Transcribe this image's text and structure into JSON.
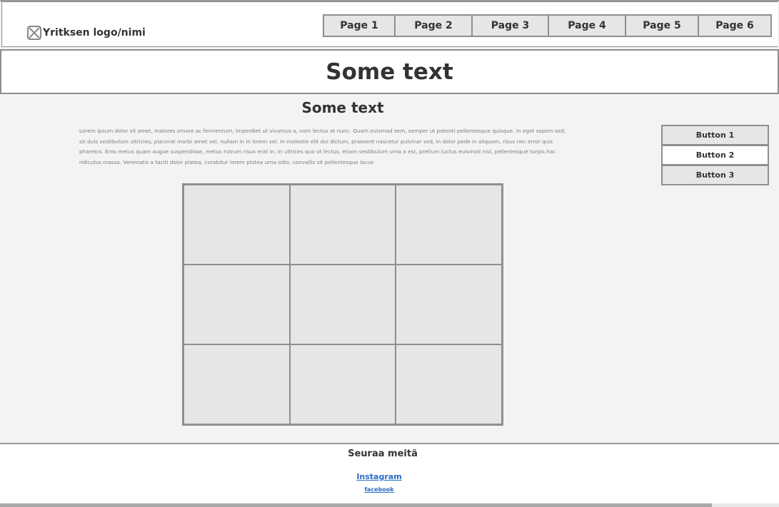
{
  "header": {
    "logo_text": "Yritksen logo/nimi",
    "nav": [
      "Page 1",
      "Page 2",
      "Page 3",
      "Page 4",
      "Page 5",
      "Page 6"
    ]
  },
  "hero": {
    "title": "Some text"
  },
  "main": {
    "subtitle": "Some text",
    "paragraph": "Lorem ipsum dolor sit amet, maiores ornare ac fermentum, imperdiet ut vivamus a, nam lectus at nunc. Quam euismod sem, semper ut potenti pellentesque quisque. In eget sapien sed, sit duis vestibulum ultricies, placerat morbi amet vel, nullam in in lorem vel. In molestie elit dui dictum, praesent nascetur pulvinar sed, in dolor pede in aliquam, risus nec error quis pharetra. Eros metus quam augue suspendisse, metus rutrum risus erat in.  In ultrices quo ut lectus, etiam vestibulum urna a est, pretium luctus euismod nisl, pellentesque turpis hac ridiculus massa. Venenatis a taciti dolor platea, curabitur lorem platea urna odio, convallis sit pellentesque lacus"
  },
  "side_buttons": [
    {
      "label": "Button 1",
      "active": false
    },
    {
      "label": "Button 2",
      "active": true
    },
    {
      "label": "Button 3",
      "active": false
    }
  ],
  "footer": {
    "title": "Seuraa meitä",
    "links": [
      "Instagram",
      "facebook"
    ]
  },
  "colors": {
    "link": "#2a6cc7",
    "border": "#8f8f8f",
    "placeholder_fill": "#e6e6e6",
    "page_background": "#f3f3f3"
  }
}
